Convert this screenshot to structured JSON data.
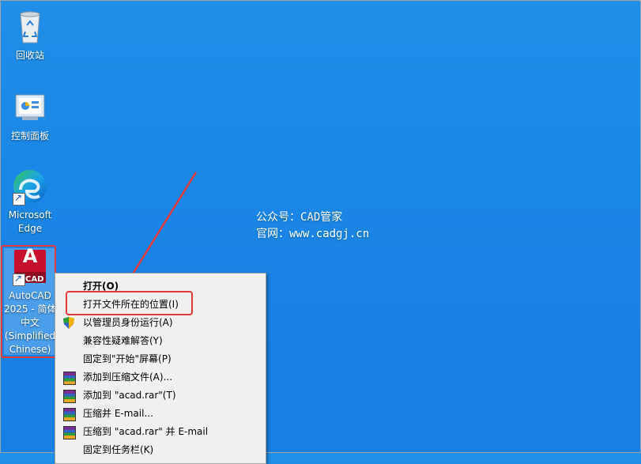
{
  "desktop": {
    "icons": [
      {
        "label": "回收站"
      },
      {
        "label": "控制面板"
      },
      {
        "label_line1": "Microsoft",
        "label_line2": "Edge"
      },
      {
        "label_lines": [
          "AutoCAD",
          "2025 - 简体",
          "中文",
          "(Simplified",
          "Chinese)"
        ],
        "badge": "CAD",
        "letter": "A"
      }
    ],
    "watermark": {
      "line1": "公众号：CAD管家",
      "line2": "官网：www.cadgj.cn"
    }
  },
  "context_menu": {
    "items": [
      {
        "label": "打开(O)"
      },
      {
        "label": "打开文件所在的位置(I)"
      },
      {
        "label": "以管理员身份运行(A)",
        "icon": "uac-shield-icon"
      },
      {
        "label": "兼容性疑难解答(Y)"
      },
      {
        "label": "固定到\"开始\"屏幕(P)"
      },
      {
        "label": "添加到压缩文件(A)...",
        "icon": "winrar-icon"
      },
      {
        "label": "添加到 \"acad.rar\"(T)",
        "icon": "winrar-icon"
      },
      {
        "label": "压缩并 E-mail...",
        "icon": "winrar-icon"
      },
      {
        "label": "压缩到 \"acad.rar\" 并 E-mail",
        "icon": "winrar-icon"
      },
      {
        "label": "固定到任务栏(K)"
      }
    ]
  },
  "colors": {
    "desktop": "#1a86e6",
    "highlight": "#e23a3a",
    "autocad_red": "#c8102e"
  }
}
